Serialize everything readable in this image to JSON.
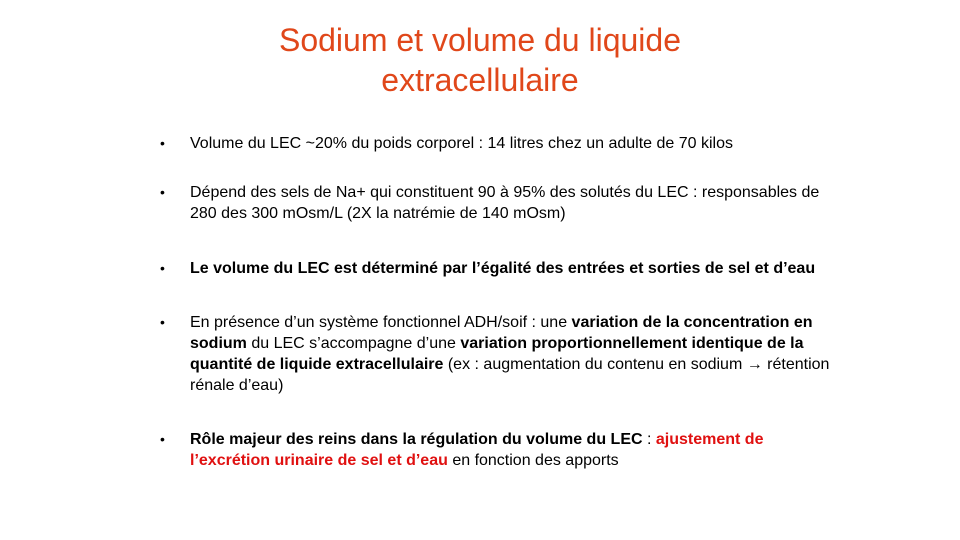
{
  "title": {
    "line1": "Sodium et volume du liquide",
    "line2": "extracellulaire"
  },
  "bullet_glyph": "•",
  "bullets": [
    {
      "text": "Volume du LEC ~20% du poids corporel : 14 litres chez un adulte de 70 kilos"
    },
    {
      "text": "Dépend des sels de Na+ qui constituent 90 à 95% des solutés du LEC : responsables de 280 des 300 mOsm/L  (2X la natrémie de 140 mOsm)"
    },
    {
      "text": "Le volume du LEC est déterminé par l’égalité des entrées et sorties de sel et d’eau"
    },
    {
      "t1": "En présence d’un système fonctionnel ADH/soif : une ",
      "b1": "variation de la concentration en sodium",
      "t2": " du LEC s’accompagne d’une ",
      "b2": "variation proportionnellement identique de la quantité de liquide extracellulaire",
      "t3": " (ex : augmentation du contenu en sodium  → rétention rénale d’eau)"
    },
    {
      "b1": "Rôle majeur des reins dans la régulation du volume du LEC",
      "t1": " : ",
      "r1": "ajustement de l’excrétion urinaire de sel et d’eau",
      "t2": " en fonction des apports"
    }
  ],
  "colors": {
    "title": "#e0471a",
    "emphasis_red": "#e01010",
    "text": "#000000",
    "background": "#ffffff"
  }
}
